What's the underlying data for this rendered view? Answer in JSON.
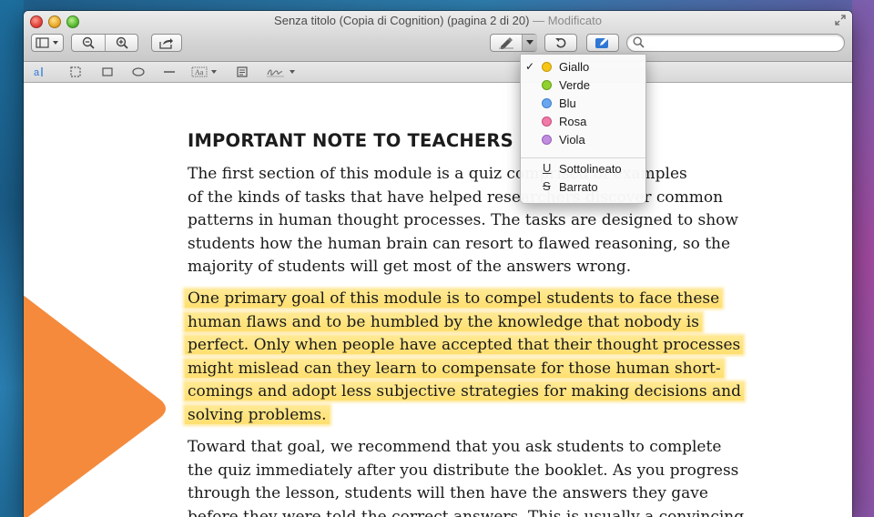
{
  "window": {
    "title": "Senza titolo (Copia di Cognition) (pagina 2 di 20)",
    "separator": "—",
    "status": "Modificato"
  },
  "search": {
    "value": "",
    "placeholder": ""
  },
  "annotation_tools": [
    "text-tool",
    "rect-selection-tool",
    "rectangle-tool",
    "oval-tool",
    "line-tool",
    "text-box-tool",
    "note-tool",
    "signature-tool"
  ],
  "document": {
    "heading": "IMPORTANT NOTE TO TEACHERS",
    "paragraphs": [
      {
        "highlighted": false,
        "lines": [
          "The first section of this module is a quiz comprised of examples",
          "of the kinds of tasks that have helped researchers discover common",
          "patterns in human thought processes. The tasks are designed to show",
          "students how the human brain can resort to flawed reasoning, so the",
          "majority of students will get most of the answers wrong."
        ]
      },
      {
        "highlighted": true,
        "lines": [
          "One primary goal of this module is to compel students to face these",
          "human flaws and to be humbled by the knowledge that nobody is",
          "perfect. Only when people have accepted that their thought processes",
          "might mislead can they learn to compensate for those human short-",
          "comings and adopt less subjective strategies for making decisions and",
          "solving problems."
        ]
      },
      {
        "highlighted": false,
        "lines": [
          "Toward that goal, we recommend that you ask students to complete",
          "the quiz immediately after you distribute the booklet. As you progress",
          "through the lesson, students will then have the answers they gave",
          "before they were told the correct answers. This is usually a convincing"
        ]
      }
    ]
  },
  "highlight_menu": {
    "colors": [
      {
        "label": "Giallo",
        "color": "#f5c518",
        "checked": true
      },
      {
        "label": "Verde",
        "color": "#8fd12e",
        "checked": false
      },
      {
        "label": "Blu",
        "color": "#6aa6ee",
        "checked": false
      },
      {
        "label": "Rosa",
        "color": "#f07aa8",
        "checked": false
      },
      {
        "label": "Viola",
        "color": "#c18de0",
        "checked": false
      }
    ],
    "styles": [
      {
        "label": "Sottolineato",
        "glyph": "U"
      },
      {
        "label": "Barrato",
        "glyph": "S"
      }
    ],
    "check_mark": "✓"
  },
  "colors": {
    "accent_blue": "#2f78d6",
    "highlight": "#ffe27a",
    "orange_shape": "#f58a3c"
  }
}
